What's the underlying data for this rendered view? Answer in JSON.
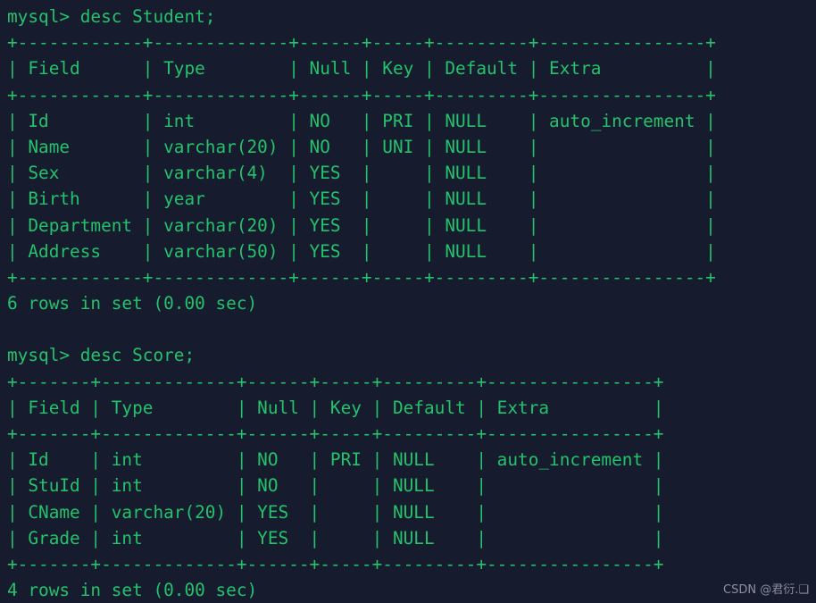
{
  "terminal": {
    "background_color": "#161b2e",
    "text_color": "#24c26b",
    "prompt": "mysql>",
    "lines": [
      "mysql> desc Student;",
      "+------------+-------------+------+-----+---------+----------------+",
      "| Field      | Type        | Null | Key | Default | Extra          |",
      "+------------+-------------+------+-----+---------+----------------+",
      "| Id         | int         | NO   | PRI | NULL    | auto_increment |",
      "| Name       | varchar(20) | NO   | UNI | NULL    |                |",
      "| Sex        | varchar(4)  | YES  |     | NULL    |                |",
      "| Birth      | year        | YES  |     | NULL    |                |",
      "| Department | varchar(20) | YES  |     | NULL    |                |",
      "| Address    | varchar(50) | YES  |     | NULL    |                |",
      "+------------+-------------+------+-----+---------+----------------+",
      "6 rows in set (0.00 sec)",
      "",
      "mysql> desc Score;",
      "+-------+-------------+------+-----+---------+----------------+",
      "| Field | Type        | Null | Key | Default | Extra          |",
      "+-------+-------------+------+-----+---------+----------------+",
      "| Id    | int         | NO   | PRI | NULL    | auto_increment |",
      "| StuId | int         | NO   |     | NULL    |                |",
      "| CName | varchar(20) | YES  |     | NULL    |                |",
      "| Grade | int         | YES  |     | NULL    |                |",
      "+-------+-------------+------+-----+---------+----------------+",
      "4 rows in set (0.00 sec)"
    ],
    "commands": [
      {
        "command": "desc Student;",
        "result_table": {
          "columns": [
            "Field",
            "Type",
            "Null",
            "Key",
            "Default",
            "Extra"
          ],
          "rows": [
            [
              "Id",
              "int",
              "NO",
              "PRI",
              "NULL",
              "auto_increment"
            ],
            [
              "Name",
              "varchar(20)",
              "NO",
              "UNI",
              "NULL",
              ""
            ],
            [
              "Sex",
              "varchar(4)",
              "YES",
              "",
              "NULL",
              ""
            ],
            [
              "Birth",
              "year",
              "YES",
              "",
              "NULL",
              ""
            ],
            [
              "Department",
              "varchar(20)",
              "YES",
              "",
              "NULL",
              ""
            ],
            [
              "Address",
              "varchar(50)",
              "YES",
              "",
              "NULL",
              ""
            ]
          ]
        },
        "status": "6 rows in set (0.00 sec)"
      },
      {
        "command": "desc Score;",
        "result_table": {
          "columns": [
            "Field",
            "Type",
            "Null",
            "Key",
            "Default",
            "Extra"
          ],
          "rows": [
            [
              "Id",
              "int",
              "NO",
              "PRI",
              "NULL",
              "auto_increment"
            ],
            [
              "StuId",
              "int",
              "NO",
              "",
              "NULL",
              ""
            ],
            [
              "CName",
              "varchar(20)",
              "YES",
              "",
              "NULL",
              ""
            ],
            [
              "Grade",
              "int",
              "YES",
              "",
              "NULL",
              ""
            ]
          ]
        },
        "status": "4 rows in set (0.00 sec)"
      }
    ]
  },
  "watermark": {
    "text": "CSDN @君衍.❑",
    "color": "#8b8f9e"
  }
}
